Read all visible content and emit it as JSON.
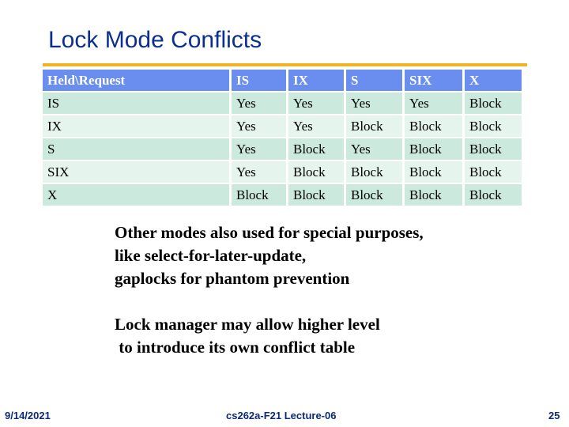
{
  "slide": {
    "title": "Lock Mode Conflicts",
    "colors": {
      "title": "#0b2f8f",
      "rule": "#f0b422",
      "header_bg": "#6a8ef0",
      "row_odd_bg": "#cbe9dd",
      "row_even_bg": "#e6f4ee",
      "footer_text": "#0b2a7a"
    }
  },
  "table": {
    "headers": [
      "Held\\Request",
      "IS",
      "IX",
      "S",
      "SIX",
      "X"
    ],
    "rows": [
      [
        "IS",
        "Yes",
        "Yes",
        "Yes",
        "Yes",
        "Block"
      ],
      [
        "IX",
        "Yes",
        "Yes",
        "Block",
        "Block",
        "Block"
      ],
      [
        "S",
        "Yes",
        "Block",
        "Yes",
        "Block",
        "Block"
      ],
      [
        "SIX",
        "Yes",
        "Block",
        "Block",
        "Block",
        "Block"
      ],
      [
        "X",
        "Block",
        "Block",
        "Block",
        "Block",
        "Block"
      ]
    ]
  },
  "notes": {
    "para1": [
      "Other modes also used for special purposes,",
      "like select-for-later-update,",
      "gaplocks for phantom prevention"
    ],
    "para2": [
      "Lock manager may allow higher level",
      " to introduce its own conflict table"
    ]
  },
  "footer": {
    "date": "9/14/2021",
    "center": "cs262a-F21 Lecture-06",
    "page": "25"
  }
}
